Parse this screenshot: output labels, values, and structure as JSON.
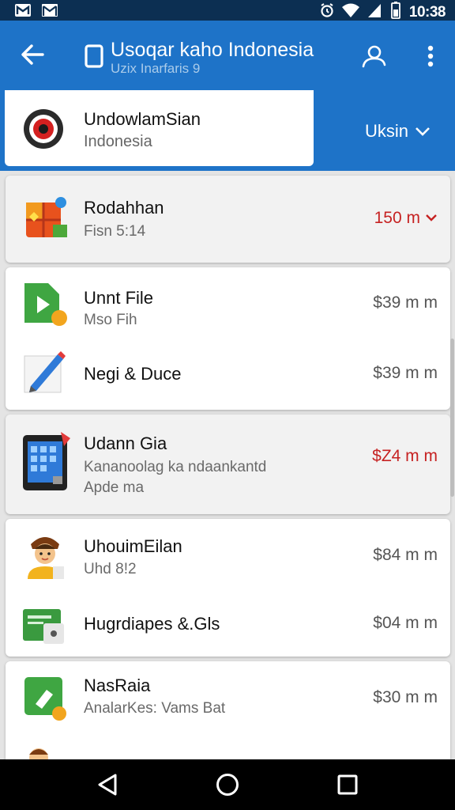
{
  "status_bar": {
    "time": "10:38",
    "icons": [
      "m-icon",
      "gmail-icon",
      "alarm-icon",
      "wifi-icon",
      "signal-icon",
      "battery-icon"
    ]
  },
  "app_bar": {
    "title": "Usoqar kaho Indonesia",
    "subtitle": "Uzix Inarfaris 9",
    "color": "#1e73c8"
  },
  "account": {
    "name": "UndowlamSian",
    "region": "Indonesia",
    "selector": "Uksin"
  },
  "items": [
    {
      "title": "Rodahhan",
      "sub": "Fisn 5:14",
      "value": "150 m",
      "red": true,
      "icon": "gift-icon"
    },
    {
      "title": "Unnt File",
      "sub": "Mso Fih",
      "value": "$39 m m",
      "icon": "green-play-icon"
    },
    {
      "title": "Negi & Duce",
      "sub": "",
      "value": "$39 m m",
      "icon": "pencil-note-icon"
    },
    {
      "title": "Udann Gia",
      "sub": "Kananoolag ka ndaankantd",
      "sub2": "Apde ma",
      "value": "$Z4 m m",
      "red": true,
      "icon": "calendar-grid-icon"
    },
    {
      "title": "UhouimEilan",
      "sub": "Uhd 8!2",
      "value": "$84 m m",
      "icon": "person-avatar-icon"
    },
    {
      "title": "Hugrdiapes &.Gls",
      "sub": "",
      "value": "$04 m m",
      "icon": "green-card-icon"
    },
    {
      "title": "NasRaia",
      "sub": "AnalarKes: Vams Bat",
      "value": "$30 m m",
      "icon": "green-tag-icon"
    }
  ],
  "colors": {
    "accent_red": "#c62222",
    "status_bar": "#0c2f52"
  }
}
